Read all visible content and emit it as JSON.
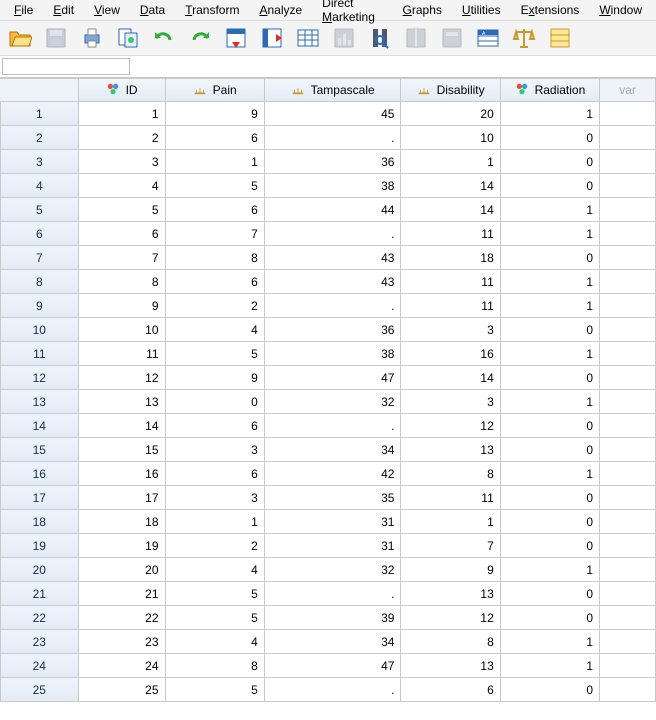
{
  "menu": {
    "items": [
      {
        "label": "File",
        "ul": "F"
      },
      {
        "label": "Edit",
        "ul": "E"
      },
      {
        "label": "View",
        "ul": "V"
      },
      {
        "label": "Data",
        "ul": "D"
      },
      {
        "label": "Transform",
        "ul": "T"
      },
      {
        "label": "Analyze",
        "ul": "A"
      },
      {
        "label": "Direct Marketing",
        "ul": "M"
      },
      {
        "label": "Graphs",
        "ul": "G"
      },
      {
        "label": "Utilities",
        "ul": "U"
      },
      {
        "label": "Extensions",
        "ul": "x"
      },
      {
        "label": "Window",
        "ul": "W"
      }
    ]
  },
  "toolbar": {
    "buttons": [
      {
        "name": "open-file-icon"
      },
      {
        "name": "save-icon"
      },
      {
        "name": "print-icon"
      },
      {
        "name": "recall-dialogs-icon"
      },
      {
        "name": "undo-icon"
      },
      {
        "name": "redo-icon"
      },
      {
        "name": "goto-case-icon"
      },
      {
        "name": "goto-variable-icon"
      },
      {
        "name": "variables-icon"
      },
      {
        "name": "run-descriptives-icon"
      },
      {
        "name": "find-icon"
      },
      {
        "name": "split-file-icon"
      },
      {
        "name": "select-cases-icon"
      },
      {
        "name": "value-labels-icon"
      },
      {
        "name": "weight-cases-icon"
      },
      {
        "name": "use-sets-icon"
      }
    ]
  },
  "editbar": {
    "value": ""
  },
  "columns": [
    {
      "key": "id",
      "label": "ID",
      "type": "nominal"
    },
    {
      "key": "pain",
      "label": "Pain",
      "type": "scale"
    },
    {
      "key": "tampa",
      "label": "Tampascale",
      "type": "scale"
    },
    {
      "key": "disability",
      "label": "Disability",
      "type": "scale"
    },
    {
      "key": "radiation",
      "label": "Radiation",
      "type": "nominal"
    }
  ],
  "empty_col_label": "var",
  "rows": [
    {
      "n": 1,
      "id": "1",
      "pain": "9",
      "tampa": "45",
      "disability": "20",
      "radiation": "1"
    },
    {
      "n": 2,
      "id": "2",
      "pain": "6",
      "tampa": ".",
      "disability": "10",
      "radiation": "0"
    },
    {
      "n": 3,
      "id": "3",
      "pain": "1",
      "tampa": "36",
      "disability": "1",
      "radiation": "0"
    },
    {
      "n": 4,
      "id": "4",
      "pain": "5",
      "tampa": "38",
      "disability": "14",
      "radiation": "0"
    },
    {
      "n": 5,
      "id": "5",
      "pain": "6",
      "tampa": "44",
      "disability": "14",
      "radiation": "1"
    },
    {
      "n": 6,
      "id": "6",
      "pain": "7",
      "tampa": ".",
      "disability": "11",
      "radiation": "1"
    },
    {
      "n": 7,
      "id": "7",
      "pain": "8",
      "tampa": "43",
      "disability": "18",
      "radiation": "0"
    },
    {
      "n": 8,
      "id": "8",
      "pain": "6",
      "tampa": "43",
      "disability": "11",
      "radiation": "1"
    },
    {
      "n": 9,
      "id": "9",
      "pain": "2",
      "tampa": ".",
      "disability": "11",
      "radiation": "1"
    },
    {
      "n": 10,
      "id": "10",
      "pain": "4",
      "tampa": "36",
      "disability": "3",
      "radiation": "0"
    },
    {
      "n": 11,
      "id": "11",
      "pain": "5",
      "tampa": "38",
      "disability": "16",
      "radiation": "1"
    },
    {
      "n": 12,
      "id": "12",
      "pain": "9",
      "tampa": "47",
      "disability": "14",
      "radiation": "0"
    },
    {
      "n": 13,
      "id": "13",
      "pain": "0",
      "tampa": "32",
      "disability": "3",
      "radiation": "1"
    },
    {
      "n": 14,
      "id": "14",
      "pain": "6",
      "tampa": ".",
      "disability": "12",
      "radiation": "0"
    },
    {
      "n": 15,
      "id": "15",
      "pain": "3",
      "tampa": "34",
      "disability": "13",
      "radiation": "0"
    },
    {
      "n": 16,
      "id": "16",
      "pain": "6",
      "tampa": "42",
      "disability": "8",
      "radiation": "1"
    },
    {
      "n": 17,
      "id": "17",
      "pain": "3",
      "tampa": "35",
      "disability": "11",
      "radiation": "0"
    },
    {
      "n": 18,
      "id": "18",
      "pain": "1",
      "tampa": "31",
      "disability": "1",
      "radiation": "0"
    },
    {
      "n": 19,
      "id": "19",
      "pain": "2",
      "tampa": "31",
      "disability": "7",
      "radiation": "0"
    },
    {
      "n": 20,
      "id": "20",
      "pain": "4",
      "tampa": "32",
      "disability": "9",
      "radiation": "1"
    },
    {
      "n": 21,
      "id": "21",
      "pain": "5",
      "tampa": ".",
      "disability": "13",
      "radiation": "0"
    },
    {
      "n": 22,
      "id": "22",
      "pain": "5",
      "tampa": "39",
      "disability": "12",
      "radiation": "0"
    },
    {
      "n": 23,
      "id": "23",
      "pain": "4",
      "tampa": "34",
      "disability": "8",
      "radiation": "1"
    },
    {
      "n": 24,
      "id": "24",
      "pain": "8",
      "tampa": "47",
      "disability": "13",
      "radiation": "1"
    },
    {
      "n": 25,
      "id": "25",
      "pain": "5",
      "tampa": ".",
      "disability": "6",
      "radiation": "0"
    }
  ],
  "colors": {
    "accent": "#2a6ab8",
    "headerbg": "#e8f0fa"
  }
}
